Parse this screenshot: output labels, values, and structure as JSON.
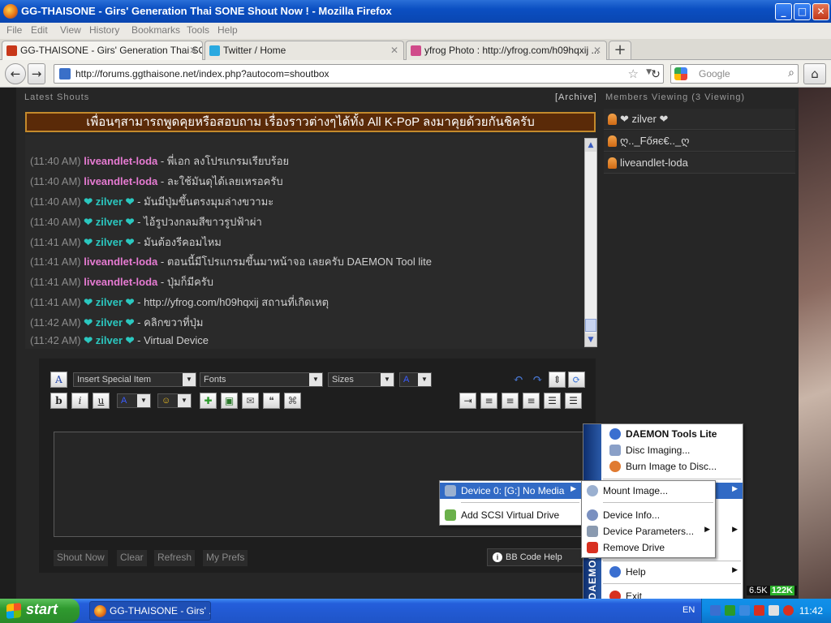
{
  "window": {
    "title": "GG-THAISONE - Girs' Generation Thai SONE Shout Now ! - Mozilla Firefox",
    "controls": [
      "_",
      "□",
      "✕"
    ]
  },
  "menubar": [
    "File",
    "Edit",
    "View",
    "History",
    "Bookmarks",
    "Tools",
    "Help"
  ],
  "tabs": [
    {
      "label": "GG-THAISONE - Girs' Generation Thai SO...",
      "close": "✕",
      "active": true,
      "icon_color": "#c8381b"
    },
    {
      "label": "Twitter / Home",
      "close": "✕",
      "active": false,
      "icon_color": "#2aa9e0"
    },
    {
      "label": "yfrog Photo : http://yfrog.com/h09hqxij ...",
      "close": "✕",
      "active": false,
      "icon_color": "#d04a8a"
    }
  ],
  "newtab": "+",
  "nav": {
    "url": "http://forums.ggthaisone.net/index.php?autocom=shoutbox",
    "search_placeholder": "Google",
    "back": "←",
    "forward": "→",
    "reload": "↻",
    "home": "⌂"
  },
  "shoutbox": {
    "header": "Latest Shouts",
    "archive": "[Archive]",
    "banner": "เพื่อนๆสามารถพูดคุยหรือสอบถาม เรื่องราวต่างๆได้ทั้ง All K-PoP ลงมาคุยด้วยกันชิครับ",
    "shouts": [
      {
        "time": "(11:40 AM)",
        "user": "liveandlet-loda",
        "type": "l",
        "text": " - พี่เอก ลงโปรแกรมเรียบร้อย"
      },
      {
        "time": "(11:40 AM)",
        "user": "liveandlet-loda",
        "type": "l",
        "text": " - ละใช้มันดุได้เลยเหรอครับ"
      },
      {
        "time": "(11:40 AM)",
        "user": "❤ zilver ❤",
        "type": "z",
        "text": " - มันมีปุ่มขึ้นตรงมุมล่างขวามะ"
      },
      {
        "time": "(11:40 AM)",
        "user": "❤ zilver ❤",
        "type": "z",
        "text": " - ไอ้รูปวงกลมสีขาวรูปฟ้าผ่า"
      },
      {
        "time": "(11:41 AM)",
        "user": "❤ zilver ❤",
        "type": "z",
        "text": " - มันต้องรีคอมไหม"
      },
      {
        "time": "(11:41 AM)",
        "user": "liveandlet-loda",
        "type": "l",
        "text": " - ตอนนี้มีโปรแกรมขึ้นมาหน้าจอ เลยครับ DAEMON Tool lite"
      },
      {
        "time": "(11:41 AM)",
        "user": "liveandlet-loda",
        "type": "l",
        "text": " - ปุ่มก็มีครับ"
      },
      {
        "time": "(11:41 AM)",
        "user": "❤ zilver ❤",
        "type": "z",
        "text": " - http://yfrog.com/h09hqxij สถานที่เกิดเหตุ"
      },
      {
        "time": "(11:42 AM)",
        "user": "❤ zilver ❤",
        "type": "z",
        "text": " - คลิกขวาที่ปุ่ม"
      },
      {
        "time": "(11:42 AM)",
        "user": "❤ zilver ❤",
        "type": "z",
        "text": " - Virtual Device"
      }
    ]
  },
  "members": {
    "header": "Members Viewing (3 Viewing)",
    "list": [
      "❤ zilver ❤",
      "ღ.._Főяє€.._ღ",
      "liveandlet-loda"
    ]
  },
  "editor": {
    "special_item": "Insert Special Item",
    "fonts": "Fonts",
    "sizes": "Sizes",
    "buttons": {
      "bold": "b",
      "italic": "i",
      "underline": "u"
    },
    "shout_now": "Shout Now",
    "clear": "Clear",
    "refresh": "Refresh",
    "prefs": "My Prefs",
    "bbcode_help": "BB Code Help"
  },
  "device_menu": {
    "device": "Device 0: [G:] No Media",
    "add_scsi": "Add SCSI Virtual Drive"
  },
  "device_submenu": [
    "Mount Image...",
    "Device Info...",
    "Device Parameters...",
    "Remove Drive"
  ],
  "daemon_menu": {
    "title": "DAEMON Tools Lite",
    "items": [
      "Disc Imaging...",
      "Burn Image to Disc..."
    ],
    "help": "Help",
    "exit": "Exit",
    "brand": "DAEMON"
  },
  "taskbar": {
    "start": "start",
    "item": "GG-THAISONE - Girs' ...",
    "lang": "EN",
    "clock": "11:42",
    "net_up": "6.5K",
    "net_down": "122K"
  }
}
